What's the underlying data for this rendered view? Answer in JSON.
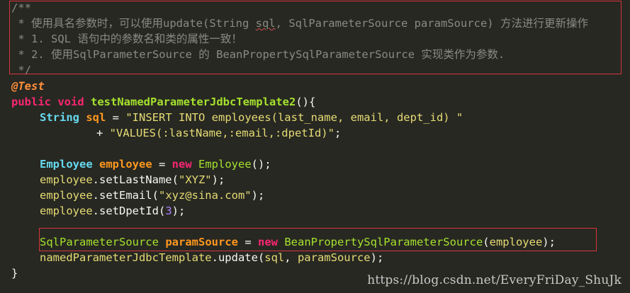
{
  "comment": {
    "open": "/**",
    "line1_prefix": " * 使用具名参数时，可以使用",
    "line1_code": "update(String ",
    "line1_sql": "sql",
    "line1_rest": ", SqlParameterSource paramSource)",
    "line1_suffix": " 方法进行更新操作",
    "line2": " * 1. SQL 语句中的参数名和类的属性一致！",
    "line3": " * 2. 使用SqlParameterSource 的 BeanPropertySqlParameterSource 实现类作为参数.",
    "close": " */"
  },
  "code": {
    "annotation": "@Test",
    "kw_public": "public",
    "kw_void": "void",
    "method_name": "testNamedParameterJdbcTemplate2",
    "method_tail": "(){",
    "type_string": "String",
    "var_sql": "sql",
    "assign": " = ",
    "str_insert": "\"INSERT INTO employees(last_name, email, dept_id) \"",
    "plus": "+ ",
    "str_values": "\"VALUES(:lastName,:email,:dpetId)\"",
    "semi": ";",
    "type_employee": "Employee",
    "var_employee": "employee",
    "kw_new": "new",
    "ctor_employee": "Employee",
    "ctor_tail": "();",
    "employee_ref": "employee",
    "call_setLastName": ".setLastName(",
    "str_xyz": "\"XYZ\"",
    "call_end": ");",
    "call_setEmail": ".setEmail(",
    "str_email": "\"xyz@sina.com\"",
    "call_setDpetId": ".setDpetId(",
    "num_3": "3",
    "type_sps": "SqlParameterSource",
    "var_paramSource": "paramSource",
    "ctor_bpsps": "BeanPropertySqlParameterSource",
    "ctor_arg_open": "(",
    "ctor_arg": "employee",
    "template_ref": "namedParameterJdbcTemplate",
    "call_update": ".update(",
    "arg_sql": "sql",
    "comma": ", ",
    "arg_paramSource": "paramSource",
    "close_brace": "}"
  },
  "watermark": "https://blog.csdn.net/EveryFriDay_ShuJk",
  "colors": {
    "background": "#272822",
    "comment": "#8a8a83",
    "annotation": "#ff8f3b",
    "keyword": "#f92672",
    "type": "#66d9ef",
    "method": "#a6e22e",
    "variable": "#fd971f",
    "string": "#e6db74",
    "number": "#ae81ff",
    "highlight_box": "#d9343b"
  }
}
